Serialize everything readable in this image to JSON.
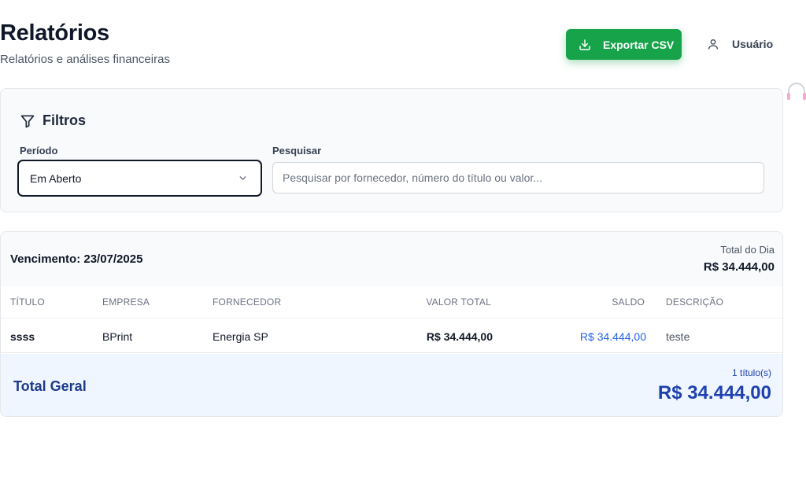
{
  "header": {
    "title": "Relatórios",
    "subtitle": "Relatórios e análises financeiras",
    "export_label": "Exportar CSV",
    "user_label": "Usuário",
    "export_color": "#16a34a"
  },
  "filters": {
    "title": "Filtros",
    "period_label": "Período",
    "period_value": "Em Aberto",
    "search_label": "Pesquisar",
    "search_placeholder": "Pesquisar por fornecedor, número do título ou valor..."
  },
  "report": {
    "group_title": "Vencimento: 23/07/2025",
    "day_total_label": "Total do Dia",
    "day_total_value": "R$ 34.444,00",
    "columns": [
      "TÍTULO",
      "EMPRESA",
      "FORNECEDOR",
      "VALOR TOTAL",
      "SALDO",
      "DESCRIÇÃO"
    ],
    "rows": [
      {
        "titulo": "ssss",
        "empresa": "BPrint",
        "fornecedor": "Energia SP",
        "valor_total": "R$ 34.444,00",
        "saldo": "R$ 34.444,00",
        "descricao": "teste"
      }
    ],
    "grand_total_label": "Total Geral",
    "grand_total_count": "1 título(s)",
    "grand_total_value": "R$ 34.444,00"
  }
}
